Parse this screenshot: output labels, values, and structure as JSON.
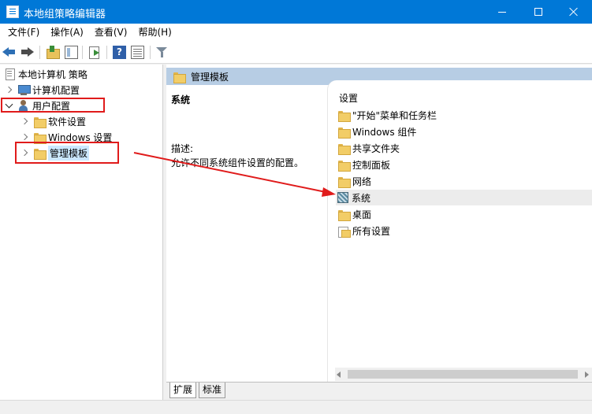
{
  "window": {
    "title": "本地组策略编辑器"
  },
  "menu": {
    "items": [
      "文件(F)",
      "操作(A)",
      "查看(V)",
      "帮助(H)"
    ]
  },
  "toolbar": {
    "icons": [
      "back-arrow-icon",
      "forward-arrow-icon",
      "folder-up-icon",
      "show-hide-tree-icon",
      "export-list-icon",
      "help-icon",
      "properties-icon",
      "filter-icon"
    ],
    "help_glyph": "?"
  },
  "tree": {
    "root": "本地计算机 策略",
    "computer_config": "计算机配置",
    "user_config": "用户配置",
    "software_settings": "软件设置",
    "windows_settings": "Windows 设置",
    "admin_templates": "管理模板"
  },
  "right": {
    "header": "管理模板",
    "desc_title": "系统",
    "desc_label": "描述:",
    "desc_text": "允许不同系统组件设置的配置。",
    "column_header": "设置",
    "items": [
      {
        "label": "\"开始\"菜单和任务栏",
        "icon": "folder-icon"
      },
      {
        "label": "Windows 组件",
        "icon": "folder-icon"
      },
      {
        "label": "共享文件夹",
        "icon": "folder-icon"
      },
      {
        "label": "控制面板",
        "icon": "folder-icon"
      },
      {
        "label": "网络",
        "icon": "folder-icon"
      },
      {
        "label": "系统",
        "icon": "system-icon"
      },
      {
        "label": "桌面",
        "icon": "folder-icon"
      },
      {
        "label": "所有设置",
        "icon": "all-settings-icon"
      }
    ]
  },
  "tabs": [
    "扩展",
    "标准"
  ],
  "colors": {
    "titlebar": "#0078d7",
    "header": "#b7cde4",
    "selection": "#cce8ff",
    "annotation": "#e01b1b"
  }
}
